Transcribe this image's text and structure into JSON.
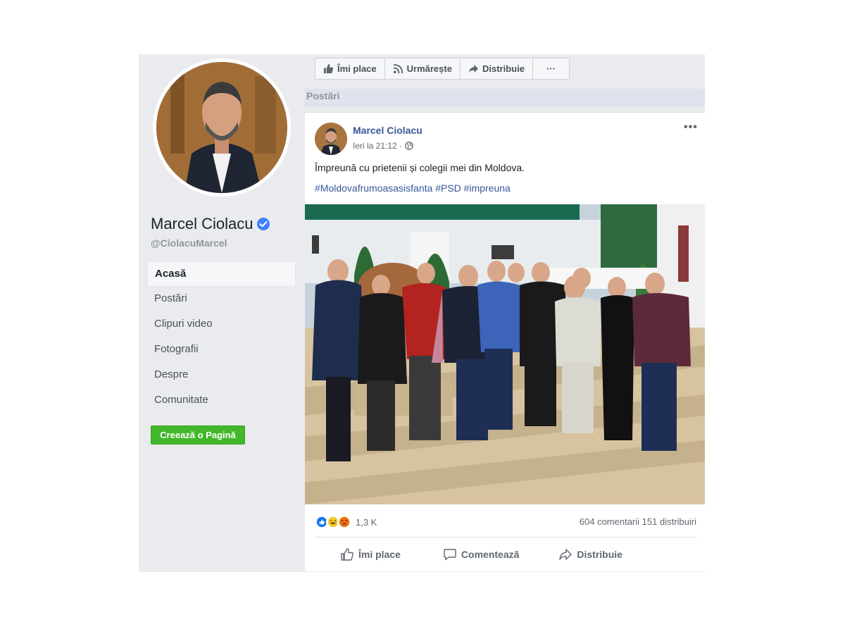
{
  "sidebar": {
    "name": "Marcel Ciolacu",
    "handle": "@CiolacuMarcel",
    "nav": [
      "Acasă",
      "Postări",
      "Clipuri video",
      "Fotografii",
      "Despre",
      "Comunitate"
    ],
    "create_page": "Creează o Pagină"
  },
  "topbar": {
    "like": "Îmi place",
    "follow": "Urmărește",
    "share": "Distribuie",
    "more": "···"
  },
  "section_title": "Postări",
  "post": {
    "author": "Marcel Ciolacu",
    "time": "Ieri la 21:12 ·",
    "text": "Împreună cu prietenii și colegii mei din Moldova.",
    "hashtags": [
      "#Moldovafrumoasasisfanta",
      "#PSD",
      "#impreuna"
    ],
    "more": "•••",
    "reaction_count": "1,3 K",
    "comments": "604 comentarii",
    "shares": "151 distribuiri",
    "actions": {
      "like": "Îmi place",
      "comment": "Comentează",
      "share": "Distribuie"
    }
  },
  "colors": {
    "link": "#385898",
    "green": "#42b72a",
    "sidebar_bg": "#e9ebee",
    "like_blue": "#1877f2"
  },
  "icons": [
    "verified-icon",
    "thumbs-up-icon",
    "rss-icon",
    "share-arrow-icon",
    "globe-icon",
    "comment-icon",
    "like-reaction-icon",
    "haha-reaction-icon",
    "angry-reaction-icon"
  ]
}
